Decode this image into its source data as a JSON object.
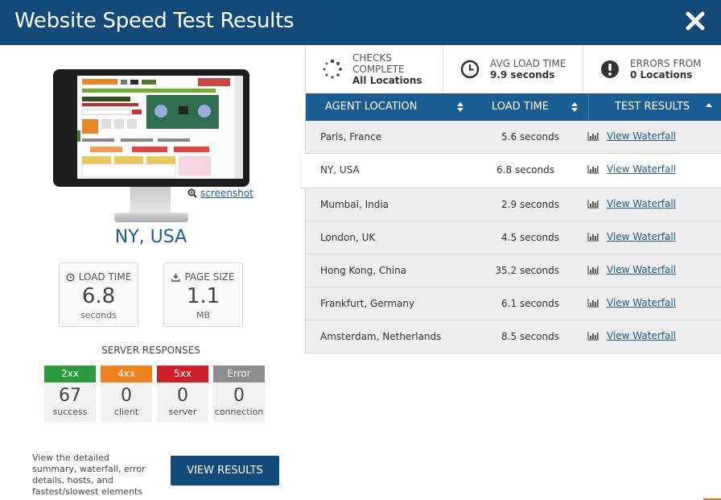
{
  "header": {
    "title": "Website Speed Test Results"
  },
  "left": {
    "screenshot_link": "screenshot",
    "location": "NY, USA",
    "load_time": {
      "label": "LOAD TIME",
      "value": "6.8",
      "unit": "seconds"
    },
    "page_size": {
      "label": "PAGE SIZE",
      "value": "1.1",
      "unit": "MB"
    },
    "server_title": "SERVER RESPONSES",
    "responses": [
      {
        "code": "2xx",
        "count": "67",
        "label": "success",
        "color": "#2e9b3f"
      },
      {
        "code": "4xx",
        "count": "0",
        "label": "client",
        "color": "#f0821e"
      },
      {
        "code": "5xx",
        "count": "0",
        "label": "server",
        "color": "#cf1f2b"
      },
      {
        "code": "Error",
        "count": "0",
        "label": "connection",
        "color": "#8d8d8d"
      }
    ],
    "footer_text": "View the detailed summary, waterfall, error details, hosts, and fastest/slowest elements",
    "view_results_label": "VIEW RESULTS"
  },
  "summary": {
    "checks": {
      "line1": "CHECKS COMPLETE",
      "line2": "All Locations"
    },
    "avg": {
      "line1": "AVG LOAD TIME",
      "line2": "9.9 seconds"
    },
    "errors": {
      "line1": "ERRORS FROM",
      "line2": "0 Locations"
    }
  },
  "table": {
    "headers": [
      "AGENT LOCATION",
      "LOAD TIME",
      "TEST RESULTS"
    ],
    "rows": [
      {
        "location": "Paris, France",
        "time": "5.6 seconds",
        "link": "View Waterfall"
      },
      {
        "location": "NY, USA",
        "time": "6.8 seconds",
        "link": "View Waterfall"
      },
      {
        "location": "Mumbai, India",
        "time": "2.9 seconds",
        "link": "View Waterfall"
      },
      {
        "location": "London, UK",
        "time": "4.5 seconds",
        "link": "View Waterfall"
      },
      {
        "location": "Hong Kong, China",
        "time": "35.2 seconds",
        "link": "View Waterfall"
      },
      {
        "location": "Frankfurt, Germany",
        "time": "6.1 seconds",
        "link": "View Waterfall"
      },
      {
        "location": "Amsterdam, Netherlands",
        "time": "8.5 seconds",
        "link": "View Waterfall"
      }
    ]
  },
  "colors": {
    "brand": "#124a78",
    "table_header": "#1a5d93",
    "link": "#1a5d93"
  }
}
